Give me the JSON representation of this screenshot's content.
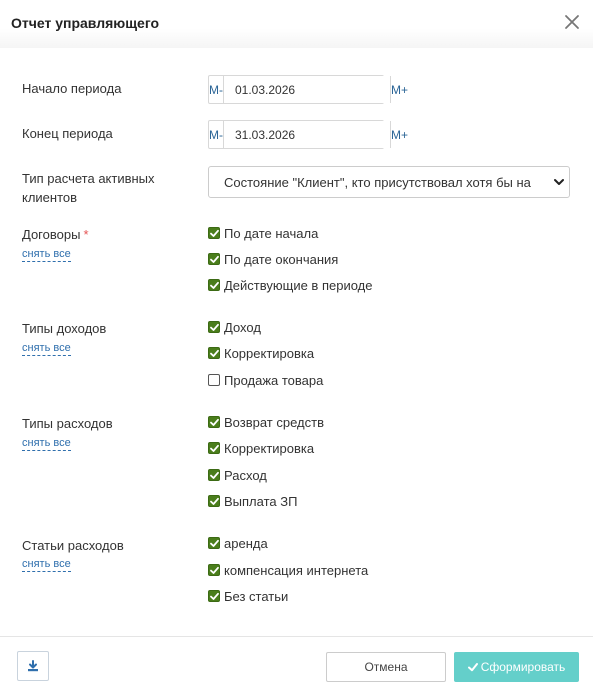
{
  "modal": {
    "title": "Отчет управляющего",
    "close_icon": "close-icon"
  },
  "period_start": {
    "label": "Начало периода",
    "minus_label": "М-",
    "value": "01.03.2026",
    "plus_label": "М+"
  },
  "period_end": {
    "label": "Конец периода",
    "minus_label": "М-",
    "value": "31.03.2026",
    "plus_label": "М+"
  },
  "client_type": {
    "label_line1": "Тип расчета активных",
    "label_line2": "клиентов",
    "selected": "Состояние \"Клиент\", кто присутствовал хотя бы на"
  },
  "contracts": {
    "label": "Договоры",
    "required_mark": "*",
    "uncheck_all": "снять все",
    "items": [
      {
        "label": "По дате начала",
        "checked": true
      },
      {
        "label": "По дате окончания",
        "checked": true
      },
      {
        "label": "Действующие в периоде",
        "checked": true
      }
    ]
  },
  "income_types": {
    "label": "Типы доходов",
    "uncheck_all": "снять все",
    "items": [
      {
        "label": "Доход",
        "checked": true
      },
      {
        "label": "Корректировка",
        "checked": true
      },
      {
        "label": "Продажа товара",
        "checked": false
      }
    ]
  },
  "expense_types": {
    "label": "Типы расходов",
    "uncheck_all": "снять все",
    "items": [
      {
        "label": "Возврат средств",
        "checked": true
      },
      {
        "label": "Корректировка",
        "checked": true
      },
      {
        "label": "Расход",
        "checked": true
      },
      {
        "label": "Выплата ЗП",
        "checked": true
      }
    ]
  },
  "expense_items": {
    "label": "Статьи расходов",
    "uncheck_all": "снять все",
    "items": [
      {
        "label": "аренда",
        "checked": true
      },
      {
        "label": "компенсация интернета",
        "checked": true
      },
      {
        "label": "Без статьи",
        "checked": true
      }
    ]
  },
  "footer": {
    "download_icon": "download-icon",
    "cancel_label": "Отмена",
    "submit_label": "Сформировать",
    "submit_icon": "check-icon"
  },
  "colors": {
    "link": "#2f6fad",
    "checkbox_checked": "#4a7d1b",
    "submit_bg": "#64cfca",
    "required": "#e55353"
  }
}
